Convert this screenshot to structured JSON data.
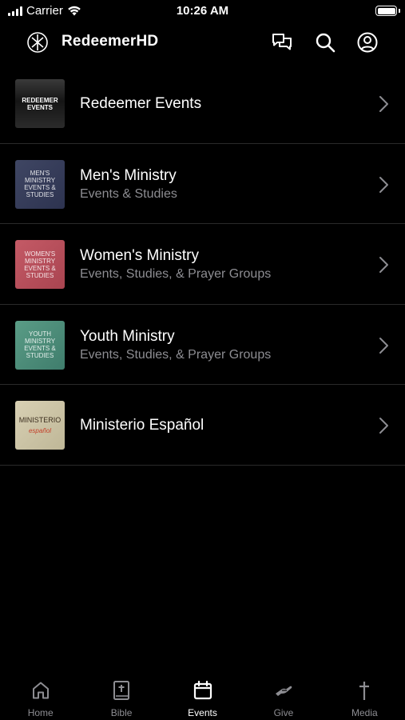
{
  "status_bar": {
    "carrier": "Carrier",
    "time": "10:26 AM"
  },
  "header": {
    "title": "RedeemerHD"
  },
  "icons": {
    "logo": "redeemer-logo-icon",
    "chat": "chat-bubbles-icon",
    "search": "search-icon",
    "account": "account-circle-icon"
  },
  "items": [
    {
      "title": "Redeemer Events",
      "subtitle": "",
      "thumb_text": "REDEEMER EVENTS"
    },
    {
      "title": "Men's Ministry",
      "subtitle": "Events & Studies",
      "thumb_text": "MEN'S MINISTRY EVENTS & STUDIES"
    },
    {
      "title": "Women's Ministry",
      "subtitle": "Events, Studies, & Prayer Groups",
      "thumb_text": "WOMEN'S MINISTRY EVENTS & STUDIES"
    },
    {
      "title": "Youth Ministry",
      "subtitle": "Events, Studies, & Prayer Groups",
      "thumb_text": "YOUTH MINISTRY EVENTS & STUDIES"
    },
    {
      "title": "Ministerio Español",
      "subtitle": "",
      "thumb_text": "MINISTERIO",
      "thumb_text2": "español"
    }
  ],
  "tabs": [
    {
      "label": "Home",
      "icon": "home-icon"
    },
    {
      "label": "Bible",
      "icon": "bible-icon"
    },
    {
      "label": "Events",
      "icon": "calendar-icon"
    },
    {
      "label": "Give",
      "icon": "give-hand-icon"
    },
    {
      "label": "Media",
      "icon": "cross-icon"
    }
  ],
  "active_tab": "Events"
}
